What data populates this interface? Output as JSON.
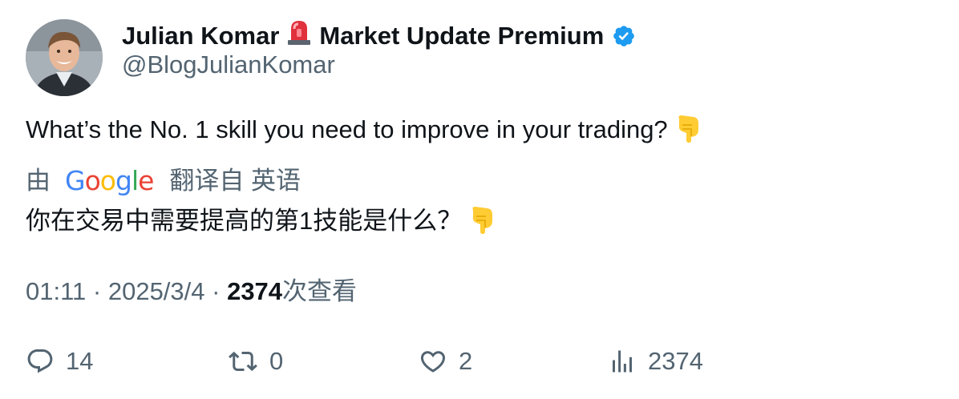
{
  "author": {
    "name": "Julian Komar",
    "name_suffix": "Market Update Premium",
    "badge_emoji": "rotating-light-emoji",
    "handle": "@BlogJulianKomar",
    "verified": true,
    "verified_color": "#1d9bf0"
  },
  "tweet": {
    "text": "What’s the No. 1 skill you need to improve in your trading?",
    "emoji": "backhand-index-pointing-down-emoji"
  },
  "translation": {
    "prefix": "由",
    "provider": "Google",
    "suffix": "翻译自 英语",
    "text": "你在交易中需要提高的第1技能是什么？"
  },
  "meta": {
    "time": "01:11",
    "separator1": " · ",
    "date": "2025/3/4",
    "separator2": " · ",
    "views": "2374",
    "views_label": "次查看"
  },
  "actions": {
    "replies": "14",
    "retweets": "0",
    "likes": "2",
    "views": "2374"
  },
  "colors": {
    "text": "#0f1419",
    "secondary": "#536471",
    "google_blue": "#4285f4",
    "google_red": "#ea4335",
    "google_yellow": "#fbbc05",
    "google_green": "#34a853"
  }
}
